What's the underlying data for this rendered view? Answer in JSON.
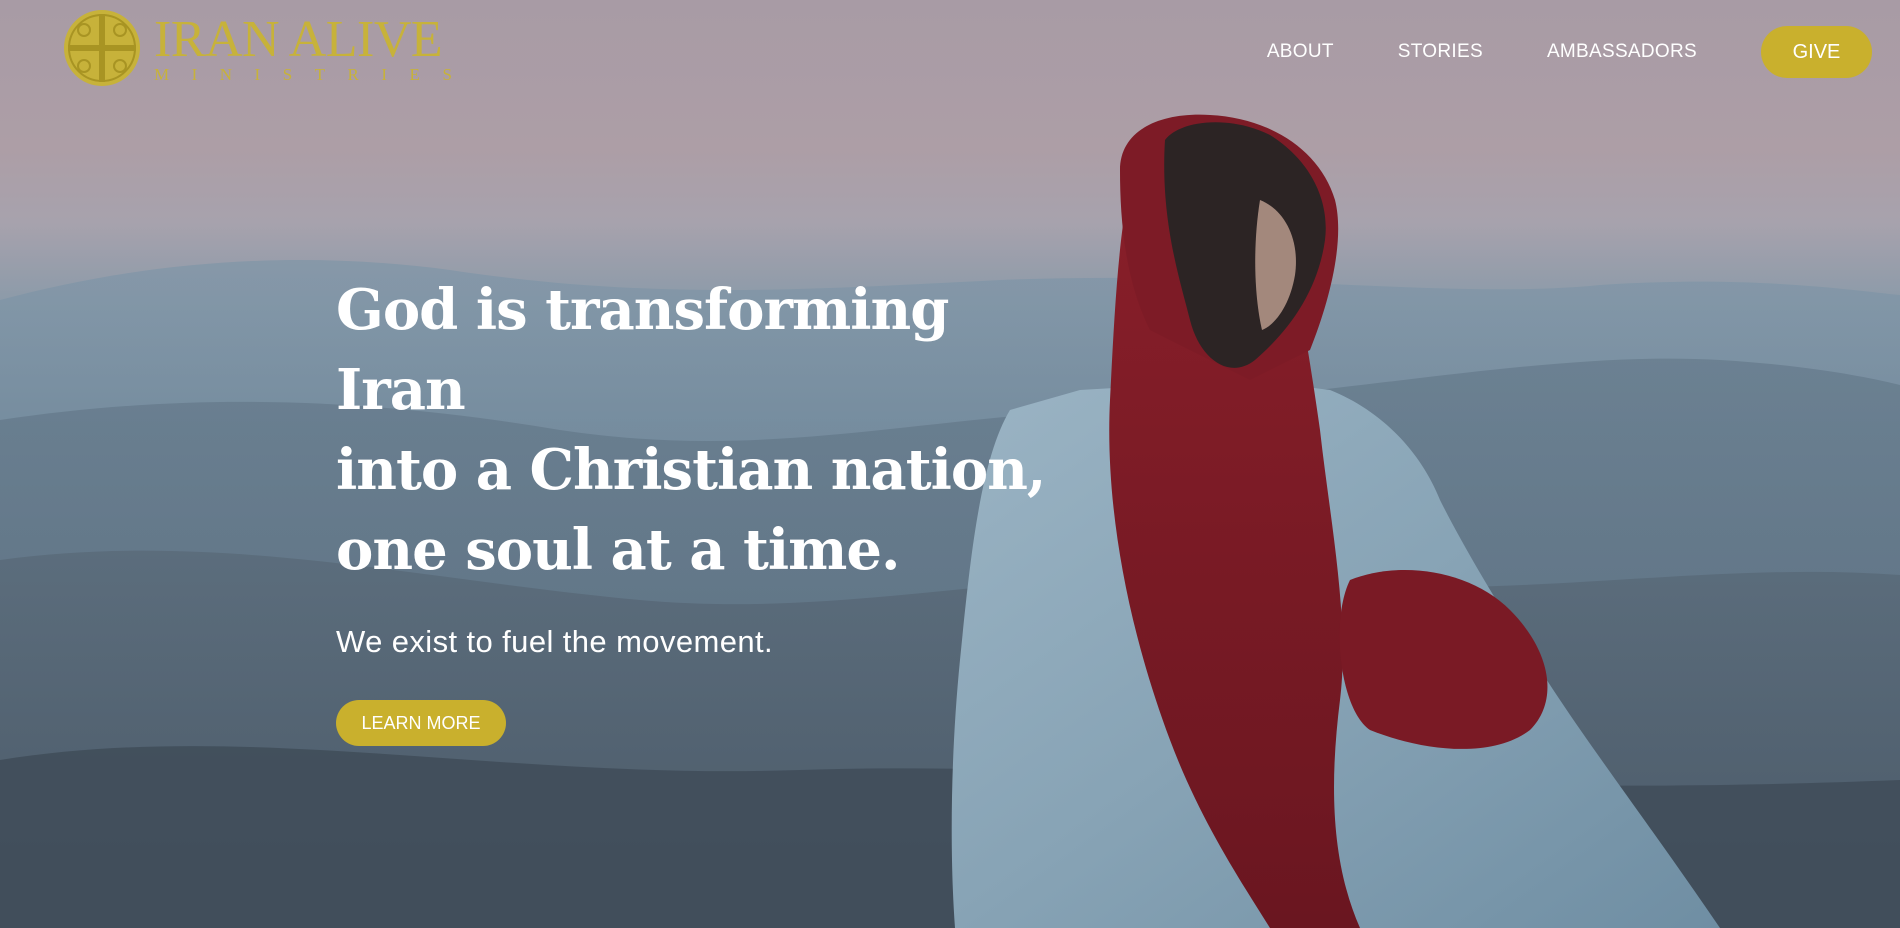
{
  "brand": {
    "title": "IRAN ALIVE",
    "subtitle": "MINISTRIES",
    "logo_color": "#c7b23a"
  },
  "nav": {
    "items": [
      {
        "label": "ABOUT"
      },
      {
        "label": "STORIES"
      },
      {
        "label": "AMBASSADORS"
      }
    ],
    "give_label": "GIVE"
  },
  "hero": {
    "headline_lines": [
      "God is transforming Iran",
      "into a Christian nation,",
      "one soul at a time."
    ],
    "subheadline": "We exist to fuel the movement.",
    "cta_label": "LEARN MORE"
  },
  "colors": {
    "accent": "#c9b02d",
    "text": "#ffffff"
  }
}
